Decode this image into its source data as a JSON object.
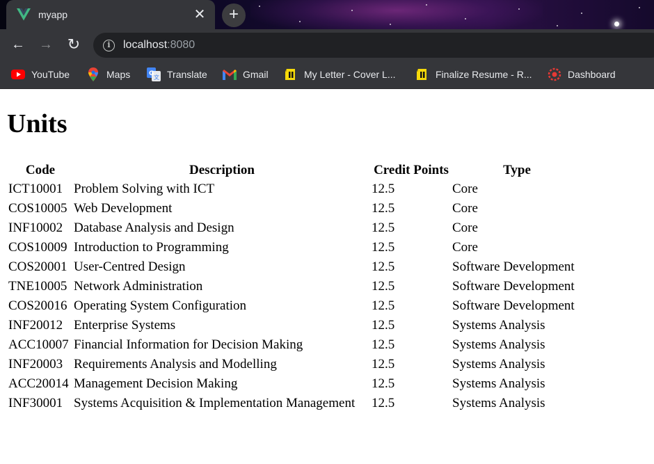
{
  "browser": {
    "tab": {
      "title": "myapp",
      "favicon": "vue-logo-icon",
      "close_glyph": "✕"
    },
    "new_tab_glyph": "+",
    "url": {
      "host": "localhost",
      "port": ":8080"
    },
    "nav": {
      "back": "←",
      "forward": "→",
      "reload": "↻",
      "info": "i"
    },
    "bookmarks": [
      {
        "label": "YouTube",
        "icon": "youtube-icon"
      },
      {
        "label": "Maps",
        "icon": "maps-pin-icon"
      },
      {
        "label": "Translate",
        "icon": "google-translate-icon"
      },
      {
        "label": "Gmail",
        "icon": "gmail-icon"
      },
      {
        "label": "My Letter - Cover L...",
        "icon": "document-icon"
      },
      {
        "label": "Finalize Resume - R...",
        "icon": "document-icon"
      },
      {
        "label": "Dashboard",
        "icon": "dashboard-icon"
      }
    ]
  },
  "page": {
    "title": "Units",
    "table": {
      "headers": [
        "Code",
        "Description",
        "Credit Points",
        "Type"
      ],
      "rows": [
        [
          "ICT10001",
          "Problem Solving with ICT",
          "12.5",
          "Core"
        ],
        [
          "COS10005",
          "Web Development",
          "12.5",
          "Core"
        ],
        [
          "INF10002",
          "Database Analysis and Design",
          "12.5",
          "Core"
        ],
        [
          "COS10009",
          "Introduction to Programming",
          "12.5",
          "Core"
        ],
        [
          "COS20001",
          "User-Centred Design",
          "12.5",
          "Software Development"
        ],
        [
          "TNE10005",
          "Network Administration",
          "12.5",
          "Software Development"
        ],
        [
          "COS20016",
          "Operating System Configuration",
          "12.5",
          "Software Development"
        ],
        [
          "INF20012",
          "Enterprise Systems",
          "12.5",
          "Systems Analysis"
        ],
        [
          "ACC10007",
          "Financial Information for Decision Making",
          "12.5",
          "Systems Analysis"
        ],
        [
          "INF20003",
          "Requirements Analysis and Modelling",
          "12.5",
          "Systems Analysis"
        ],
        [
          "ACC20014",
          "Management Decision Making",
          "12.5",
          "Systems Analysis"
        ],
        [
          "INF30001",
          "Systems Acquisition & Implementation Management",
          "12.5",
          "Systems Analysis"
        ]
      ]
    }
  }
}
